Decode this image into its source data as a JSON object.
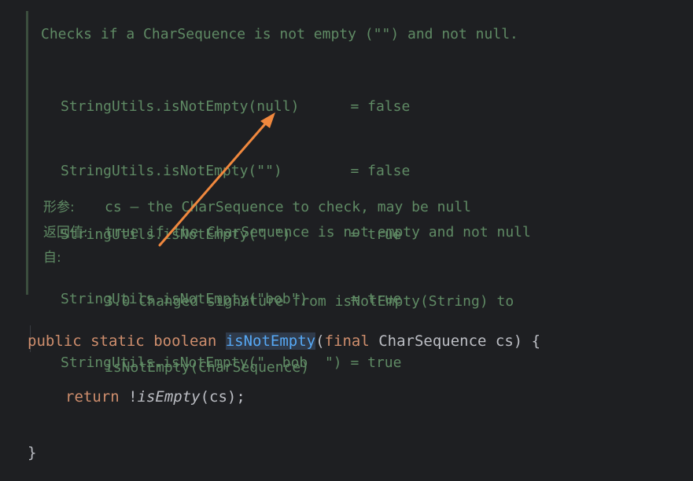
{
  "doc": {
    "summary": "Checks if a CharSequence is not empty (\"\") and not null.",
    "examples": [
      "StringUtils.isNotEmpty(null)      = false",
      "StringUtils.isNotEmpty(\"\")        = false",
      "StringUtils.isNotEmpty(\" \")       = true",
      "StringUtils.isNotEmpty(\"bob\")     = true",
      "StringUtils.isNotEmpty(\"  bob  \") = true"
    ],
    "tags": {
      "params_label": "形参:",
      "params_value": "cs – the CharSequence to check, may be null",
      "returns_label": "返回值:",
      "returns_value": "true if the CharSequence is not empty and not null",
      "since_label": "自:",
      "since_value_line1": "3.0 Changed signature from isNotEmpty(String) to",
      "since_value_line2": "isNotEmpty(CharSequence)"
    }
  },
  "code": {
    "line1": {
      "kw1": "public",
      "kw2": "static",
      "kw3": "boolean",
      "method": "isNotEmpty",
      "paren_open": "(",
      "kw4": "final",
      "param": " CharSequence cs) {"
    },
    "line2": {
      "kw": "return",
      "not": " !",
      "call": "isEmpty",
      "args": "(cs);"
    },
    "line3": "}"
  },
  "colors": {
    "background": "#1e1f22",
    "doc_text": "#5f8a64",
    "keyword": "#cf8e6d",
    "method_highlight": "#56a8f5",
    "code_text": "#bcbec4",
    "arrow": "#f0883e"
  }
}
